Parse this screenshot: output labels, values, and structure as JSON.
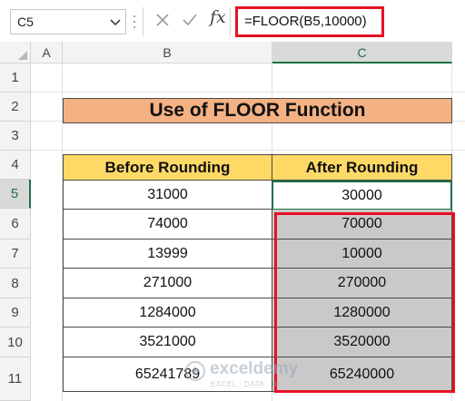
{
  "formula_bar": {
    "name_box": "C5",
    "fx_label": "fx",
    "formula": "=FLOOR(B5,10000)"
  },
  "columns": [
    "A",
    "B",
    "C"
  ],
  "rows": [
    "1",
    "2",
    "3",
    "4",
    "5",
    "6",
    "7",
    "8",
    "9",
    "10",
    "11"
  ],
  "sheet": {
    "title": "Use of FLOOR Function",
    "headers": [
      "Before Rounding",
      "After Rounding"
    ],
    "table": [
      [
        "31000",
        "30000"
      ],
      [
        "74000",
        "70000"
      ],
      [
        "13999",
        "10000"
      ],
      [
        "271000",
        "270000"
      ],
      [
        "1284000",
        "1280000"
      ],
      [
        "3521000",
        "3520000"
      ],
      [
        "65241789",
        "65240000"
      ]
    ]
  },
  "watermark": {
    "name": "exceldemy",
    "tagline": "EXCEL · DATA · BI"
  },
  "colors": {
    "title_fill": "#f4b183",
    "header_fill": "#ffd966",
    "result_fill": "#c9c9c9",
    "highlight": "#e81123",
    "excel_green": "#1e7145"
  }
}
